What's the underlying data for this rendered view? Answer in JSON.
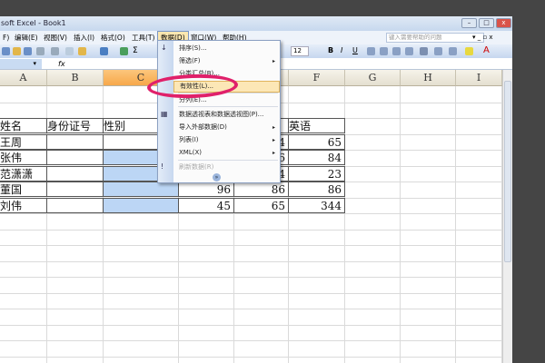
{
  "window": {
    "title": "soft Excel - Book1",
    "min": "–",
    "max": "□",
    "close": "x"
  },
  "menubar": {
    "items": [
      "F)",
      "编辑(E)",
      "视图(V)",
      "插入(I)",
      "格式(O)",
      "工具(T)",
      "数据(D)",
      "窗口(W)",
      "帮助(H)"
    ],
    "help_placeholder": "键入需要帮助的问题",
    "doc_controls": "▾ _ ▫ x"
  },
  "toolbar": {
    "font_size": "12",
    "bold": "B",
    "italic": "I",
    "underline": "U"
  },
  "formula_bar": {
    "fx": "fx"
  },
  "columns": [
    "A",
    "B",
    "C",
    "D",
    "E",
    "F",
    "G",
    "H",
    "I"
  ],
  "selected_column": "C",
  "table": {
    "headers": [
      "姓名",
      "身份证号",
      "性别",
      "",
      "",
      "英语"
    ],
    "rows": [
      {
        "name": "王周",
        "d": "",
        "e": "4",
        "f": "65"
      },
      {
        "name": "张伟",
        "d": "",
        "e": "6",
        "f": "84"
      },
      {
        "name": "范潇潇",
        "d": "",
        "e": "4",
        "f": "23"
      },
      {
        "name": "董国",
        "d": "96",
        "e": "86",
        "f": "86"
      },
      {
        "name": "刘伟",
        "d": "45",
        "e": "65",
        "f": "344"
      }
    ]
  },
  "data_menu": {
    "items": [
      {
        "label": "排序(S)...",
        "icon": "sort-icon"
      },
      {
        "label": "筛选(F)",
        "submenu": true
      },
      {
        "label": "分类汇总(B)..."
      },
      {
        "label": "有效性(L)...",
        "highlighted": true
      },
      {
        "label": "分列(E)..."
      },
      {
        "label": "数据透视表和数据透视图(P)...",
        "icon": "pivot-icon"
      },
      {
        "label": "导入外部数据(D)",
        "submenu": true
      },
      {
        "label": "列表(I)",
        "submenu": true
      },
      {
        "label": "XML(X)",
        "submenu": true
      },
      {
        "label": "刷新数据(R)",
        "disabled": true,
        "icon": "refresh-icon"
      }
    ],
    "expand": "»"
  },
  "colors": {
    "highlight_ellipse": "#e0206a",
    "selection": "#bcd6f5",
    "selected_header": "#f7a84a"
  }
}
